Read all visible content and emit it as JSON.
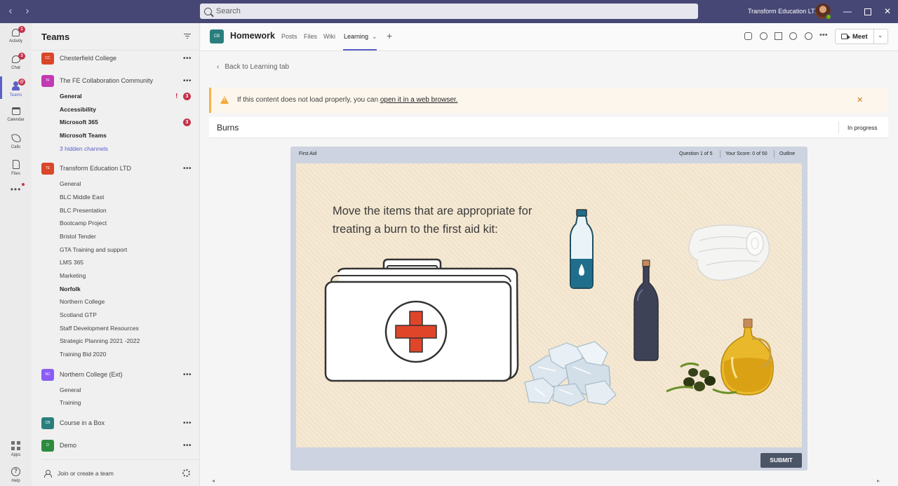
{
  "titlebar": {
    "search_placeholder": "Search",
    "tenant_name": "Transform Education LTD"
  },
  "rail": {
    "items": [
      {
        "label": "Activity",
        "icon": "bell-icon",
        "badge": "1"
      },
      {
        "label": "Chat",
        "icon": "chat-icon",
        "badge": "3"
      },
      {
        "label": "Teams",
        "icon": "teams-icon",
        "badge": "@"
      },
      {
        "label": "Calendar",
        "icon": "calendar-icon"
      },
      {
        "label": "Calls",
        "icon": "phone-icon"
      },
      {
        "label": "Files",
        "icon": "file-icon"
      },
      {
        "label": "Apps",
        "icon": "apps-icon"
      },
      {
        "label": "Help",
        "icon": "help-icon"
      }
    ]
  },
  "panel": {
    "title": "Teams",
    "teams": [
      {
        "initials": "CC",
        "name": "Chesterfield College",
        "color": "#d9472b",
        "channels": []
      },
      {
        "initials": "TF",
        "name": "The FE Collaboration Community",
        "color": "#c239b3",
        "channels": [
          {
            "name": "General",
            "bold": true,
            "alert": "!",
            "badge": "3"
          },
          {
            "name": "Accessibility",
            "bold": true
          },
          {
            "name": "Microsoft 365",
            "bold": true,
            "badge": "3"
          },
          {
            "name": "Microsoft Teams",
            "bold": true
          },
          {
            "name": "3 hidden channels",
            "hidden": true
          }
        ]
      },
      {
        "initials": "TE",
        "name": "Transform Education LTD",
        "color": "#d9472b",
        "channels": [
          {
            "name": "General"
          },
          {
            "name": "BLC Middle East"
          },
          {
            "name": "BLC Presentation"
          },
          {
            "name": "Bootcamp Project"
          },
          {
            "name": "Bristol Tender"
          },
          {
            "name": "GTA Training and support"
          },
          {
            "name": "LMS 365"
          },
          {
            "name": "Marketing"
          },
          {
            "name": "Norfolk",
            "bold": true
          },
          {
            "name": "Northern College"
          },
          {
            "name": "Scotland GTP"
          },
          {
            "name": "Staff Development Resources"
          },
          {
            "name": "Strategic Planning 2021 -2022"
          },
          {
            "name": "Training Bid 2020"
          }
        ]
      },
      {
        "initials": "NC",
        "name": "Northern College (Ext)",
        "color": "#8b5cf6",
        "channels": [
          {
            "name": "General"
          },
          {
            "name": "Training"
          }
        ]
      },
      {
        "initials": "CB",
        "name": "Course in a Box",
        "color": "#2a7f7e",
        "channels": []
      },
      {
        "initials": "D",
        "name": "Demo",
        "color": "#2e8b3d",
        "channels": []
      }
    ],
    "join_label": "Join or create a team"
  },
  "header": {
    "avatar_initials": "CB",
    "title": "Homework",
    "tabs": [
      "Posts",
      "Files",
      "Wiki",
      "Learning"
    ],
    "meet_label": "Meet"
  },
  "content": {
    "back_label": "Back to Learning tab",
    "warning_prefix": "If this content does not load properly, you can ",
    "warning_link": "open it in a web browser.",
    "course_title": "Burns",
    "status": "In progress"
  },
  "player": {
    "name": "First Aid",
    "question_counter": "Question 1 of 5",
    "score": "Your Score: 0 of 50",
    "outline": "Outline",
    "question": "Move the items that are appropriate for treating a burn to the first aid kit:",
    "submit_label": "SUBMIT",
    "accent": "#e0452a"
  }
}
